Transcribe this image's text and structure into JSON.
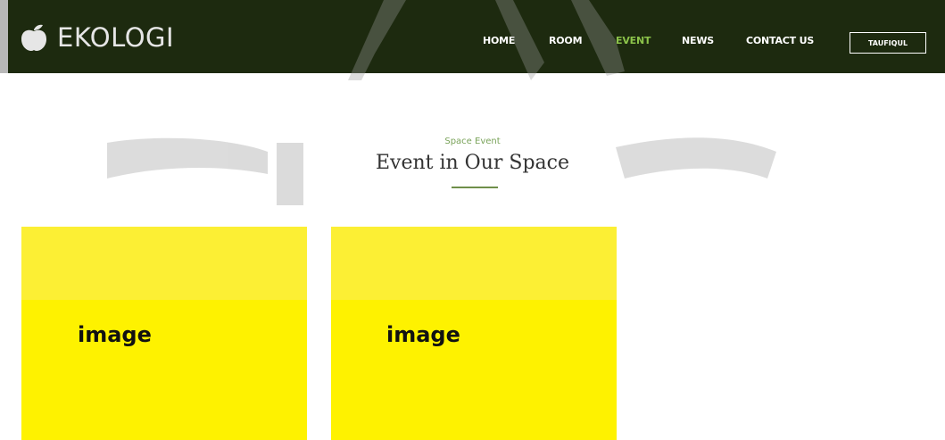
{
  "header": {
    "brand": "EKOLOGI",
    "logo_icon": "apple-icon",
    "nav": [
      {
        "label": "HOME",
        "active": false
      },
      {
        "label": "ROOM",
        "active": false
      },
      {
        "label": "EVENT",
        "active": true
      },
      {
        "label": "NEWS",
        "active": false
      },
      {
        "label": "CONTACT US",
        "active": false
      }
    ],
    "user_button": "TAUFIQUL"
  },
  "section": {
    "subtitle": "Space Event",
    "title": "Event in Our Space"
  },
  "cards": [
    {
      "label": "image"
    },
    {
      "label": "image"
    }
  ],
  "colors": {
    "header_bg": "#1d2a0f",
    "accent": "#8cc34a",
    "card_yellow": "#fef200"
  }
}
